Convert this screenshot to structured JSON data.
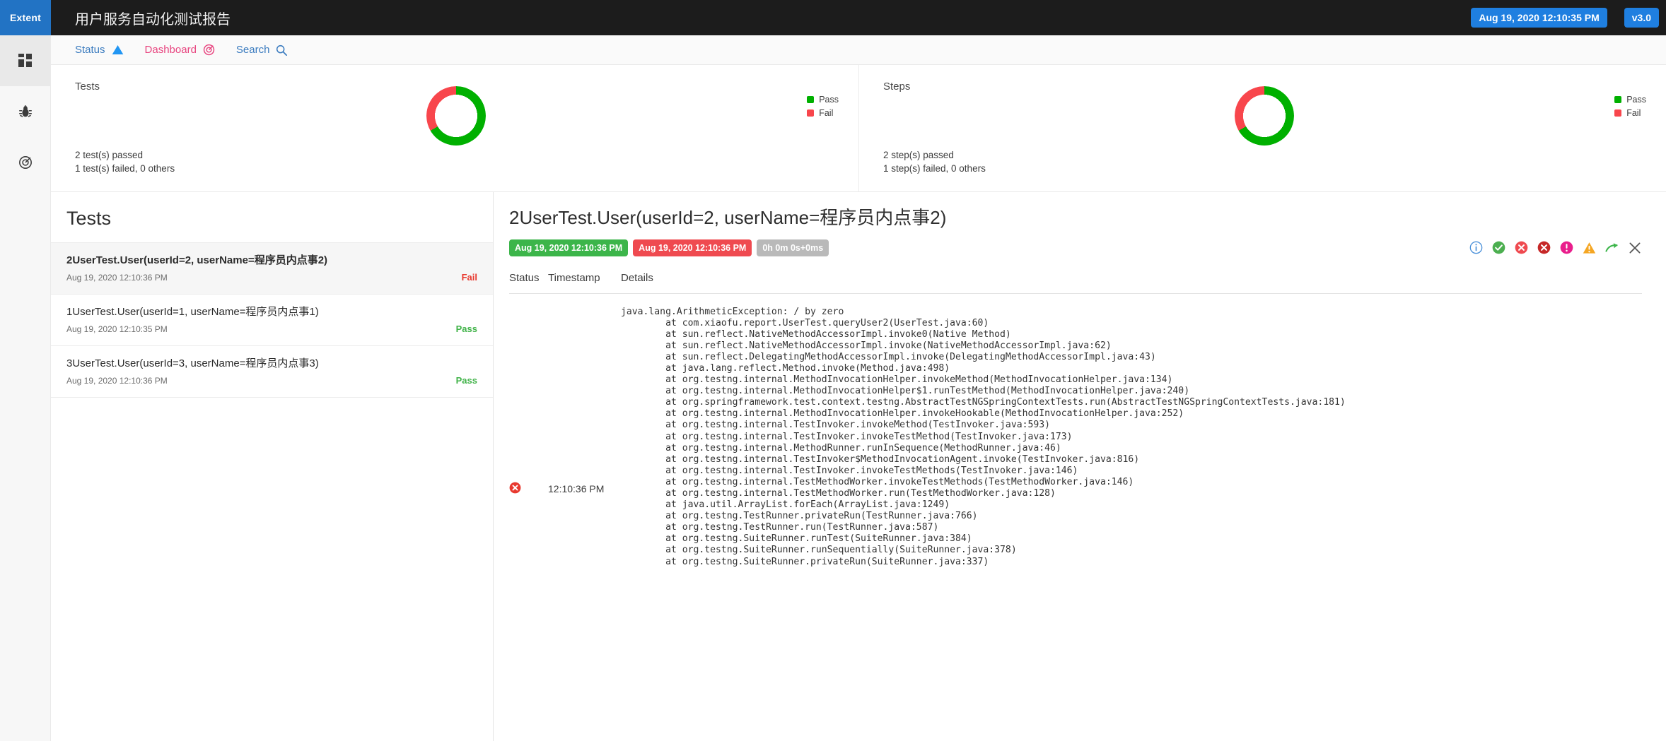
{
  "topbar": {
    "brand": "Extent",
    "report_title": "用户服务自动化测试报告",
    "timestamp_badge": "Aug 19, 2020 12:10:35 PM",
    "version_badge": "v3.0",
    "accent": "#2273c4"
  },
  "rail": {
    "items": [
      {
        "icon": "grid-icon",
        "name": "dashboard",
        "active": true
      },
      {
        "icon": "bug-icon",
        "name": "tests",
        "active": false
      },
      {
        "icon": "target-icon",
        "name": "categories",
        "active": false
      }
    ]
  },
  "navtabs": [
    {
      "label": "Status",
      "icon": "triangle-icon",
      "color": "#3a7bbf"
    },
    {
      "label": "Dashboard",
      "icon": "target-icon",
      "color": "#e8447f"
    },
    {
      "label": "Search",
      "icon": "search-icon",
      "color": "#3a7bbf"
    }
  ],
  "summary": {
    "legend": [
      {
        "label": "Pass",
        "color": "#00b000"
      },
      {
        "label": "Fail",
        "color": "#f8464c"
      }
    ],
    "cards": [
      {
        "title": "Tests",
        "passed_text": "2 test(s) passed",
        "failed_text": "1 test(s) failed, 0 others"
      },
      {
        "title": "Steps",
        "passed_text": "2 step(s) passed",
        "failed_text": "1 step(s) failed, 0 others"
      }
    ]
  },
  "chart_data": [
    {
      "type": "pie",
      "title": "Tests",
      "categories": [
        "Pass",
        "Fail"
      ],
      "values": [
        2,
        1
      ],
      "colors": [
        "#00b000",
        "#f8464c"
      ],
      "legend_position": "right",
      "donut": true,
      "xlabel": "",
      "ylabel": ""
    },
    {
      "type": "pie",
      "title": "Steps",
      "categories": [
        "Pass",
        "Fail"
      ],
      "values": [
        2,
        1
      ],
      "colors": [
        "#00b000",
        "#f8464c"
      ],
      "legend_position": "right",
      "donut": true,
      "xlabel": "",
      "ylabel": ""
    }
  ],
  "testlist": {
    "heading": "Tests",
    "items": [
      {
        "name": "2UserTest.User(userId=2, userName=程序员内点事2)",
        "time": "Aug 19, 2020 12:10:36 PM",
        "status": "Fail",
        "selected": true
      },
      {
        "name": "1UserTest.User(userId=1, userName=程序员内点事1)",
        "time": "Aug 19, 2020 12:10:35 PM",
        "status": "Pass",
        "selected": false
      },
      {
        "name": "3UserTest.User(userId=3, userName=程序员内点事3)",
        "time": "Aug 19, 2020 12:10:36 PM",
        "status": "Pass",
        "selected": false
      }
    ]
  },
  "detail": {
    "title": "2UserTest.User(userId=2, userName=程序员内点事2)",
    "start_chip": "Aug 19, 2020 12:10:36 PM",
    "end_chip": "Aug 19, 2020 12:10:36 PM",
    "duration_chip": "0h 0m 0s+0ms",
    "status_icons": [
      {
        "name": "info-icon",
        "color": "#4a90d9"
      },
      {
        "name": "check-circle-icon",
        "color": "#4caf50"
      },
      {
        "name": "x-circle-icon",
        "color": "#ef4a50"
      },
      {
        "name": "x-circle-dark-icon",
        "color": "#c62828"
      },
      {
        "name": "exclamation-circle-icon",
        "color": "#e91e8c"
      },
      {
        "name": "warning-triangle-icon",
        "color": "#f5a623"
      },
      {
        "name": "skip-arrow-icon",
        "color": "#3cb54a"
      },
      {
        "name": "close-icon",
        "color": "#555555"
      }
    ],
    "columns": [
      "Status",
      "Timestamp",
      "Details"
    ],
    "row": {
      "status_icon": "x-circle-icon",
      "timestamp": "12:10:36 PM",
      "details": "java.lang.ArithmeticException: / by zero\n        at com.xiaofu.report.UserTest.queryUser2(UserTest.java:60)\n        at sun.reflect.NativeMethodAccessorImpl.invoke0(Native Method)\n        at sun.reflect.NativeMethodAccessorImpl.invoke(NativeMethodAccessorImpl.java:62)\n        at sun.reflect.DelegatingMethodAccessorImpl.invoke(DelegatingMethodAccessorImpl.java:43)\n        at java.lang.reflect.Method.invoke(Method.java:498)\n        at org.testng.internal.MethodInvocationHelper.invokeMethod(MethodInvocationHelper.java:134)\n        at org.testng.internal.MethodInvocationHelper$1.runTestMethod(MethodInvocationHelper.java:240)\n        at org.springframework.test.context.testng.AbstractTestNGSpringContextTests.run(AbstractTestNGSpringContextTests.java:181)\n        at org.testng.internal.MethodInvocationHelper.invokeHookable(MethodInvocationHelper.java:252)\n        at org.testng.internal.TestInvoker.invokeMethod(TestInvoker.java:593)\n        at org.testng.internal.TestInvoker.invokeTestMethod(TestInvoker.java:173)\n        at org.testng.internal.MethodRunner.runInSequence(MethodRunner.java:46)\n        at org.testng.internal.TestInvoker$MethodInvocationAgent.invoke(TestInvoker.java:816)\n        at org.testng.internal.TestInvoker.invokeTestMethods(TestInvoker.java:146)\n        at org.testng.internal.TestMethodWorker.invokeTestMethods(TestMethodWorker.java:146)\n        at org.testng.internal.TestMethodWorker.run(TestMethodWorker.java:128)\n        at java.util.ArrayList.forEach(ArrayList.java:1249)\n        at org.testng.TestRunner.privateRun(TestRunner.java:766)\n        at org.testng.TestRunner.run(TestRunner.java:587)\n        at org.testng.SuiteRunner.runTest(SuiteRunner.java:384)\n        at org.testng.SuiteRunner.runSequentially(SuiteRunner.java:378)\n        at org.testng.SuiteRunner.privateRun(SuiteRunner.java:337)"
    }
  }
}
